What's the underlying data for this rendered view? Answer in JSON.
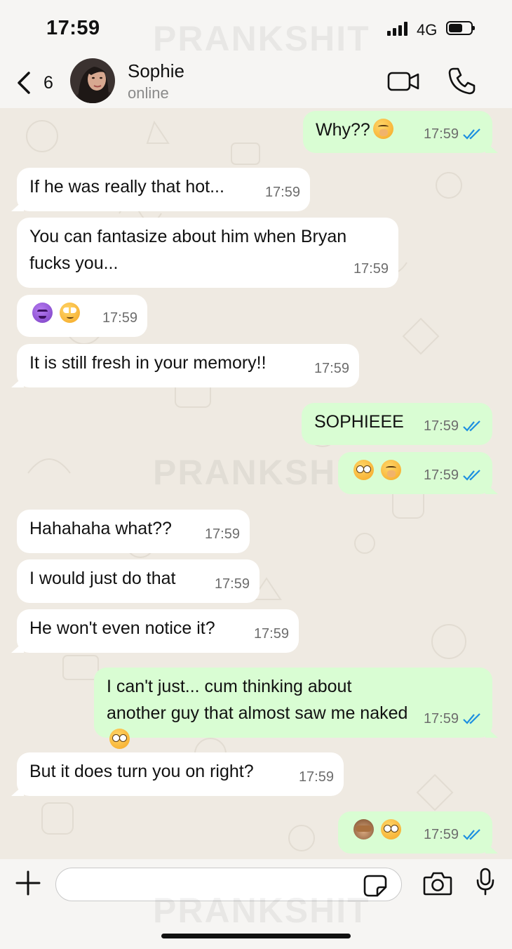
{
  "status_bar": {
    "time": "17:59",
    "network": "4G"
  },
  "header": {
    "back_count": "6",
    "contact_name": "Sophie",
    "contact_status": "online"
  },
  "watermark": "PRANKSHIT",
  "messages": [
    {
      "dir": "out",
      "text": "Why??",
      "emojis": [
        "hush"
      ],
      "time": "17:59",
      "read": true
    },
    {
      "dir": "in",
      "text": "If he was really that hot...",
      "time": "17:59"
    },
    {
      "dir": "in",
      "text": "You can fantasize about him when Bryan fucks you...",
      "time": "17:59"
    },
    {
      "dir": "in",
      "text": "",
      "emojis": [
        "devil",
        "roll"
      ],
      "time": "17:59"
    },
    {
      "dir": "in",
      "text": "It is still fresh in your memory!!",
      "time": "17:59"
    },
    {
      "dir": "out",
      "text": "SOPHIEEE",
      "time": "17:59",
      "read": true
    },
    {
      "dir": "out",
      "text": "",
      "emojis": [
        "flushed",
        "hush"
      ],
      "time": "17:59",
      "read": true
    },
    {
      "dir": "in",
      "text": "Hahahaha what??",
      "time": "17:59"
    },
    {
      "dir": "in",
      "text": "I would just do that",
      "time": "17:59"
    },
    {
      "dir": "in",
      "text": "He won't even notice it?",
      "time": "17:59"
    },
    {
      "dir": "out",
      "text": "I can't just... cum thinking about another guy that almost saw me naked",
      "emojis": [
        "flushed"
      ],
      "time": "17:59",
      "read": true
    },
    {
      "dir": "in",
      "text": "But it does turn you on right?",
      "time": "17:59"
    },
    {
      "dir": "out",
      "text": "",
      "emojis": [
        "monkey",
        "flushed"
      ],
      "time": "17:59",
      "read": true
    }
  ],
  "input": {
    "placeholder": "",
    "value": ""
  },
  "colors": {
    "incoming": "#ffffff",
    "outgoing": "#d9fdd3",
    "read_tick": "#1d8fe0",
    "wallpaper": "#efeae2"
  }
}
